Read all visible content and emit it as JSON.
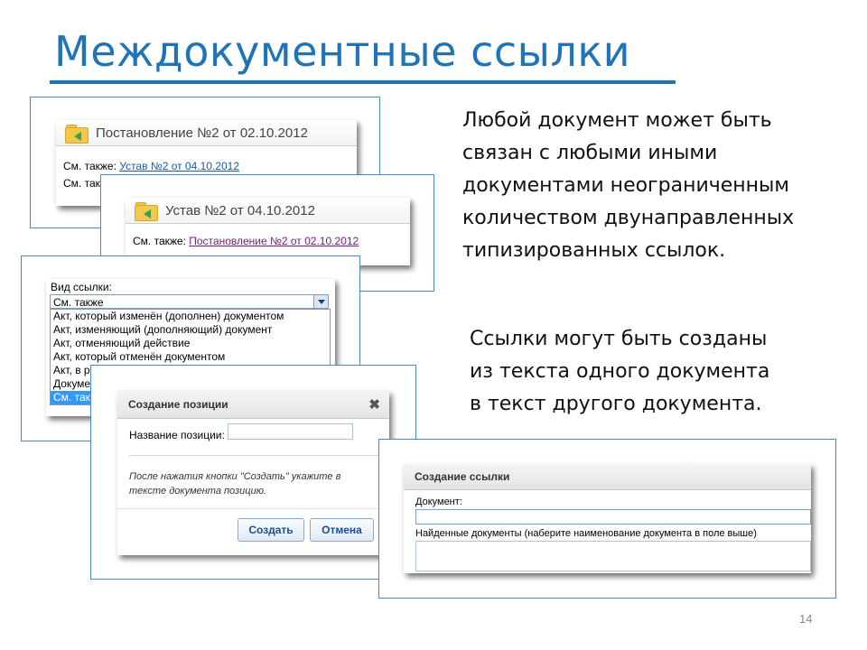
{
  "slide": {
    "title": "Междокументные ссылки",
    "paragraph1": [
      "Любой документ может быть",
      "связан с любыми иными",
      "документами неограниченным",
      "количеством двунаправленных",
      "типизированных ссылок."
    ],
    "paragraph2": [
      "Ссылки могут быть созданы",
      "из текста одного документа",
      "в текст другого документа."
    ],
    "page_number": "14",
    "accent_color": "#1f74b7"
  },
  "doc_card_1": {
    "title": "Постановление №2 от 02.10.2012",
    "see_also_label": "См. также:",
    "see_also_link": "Устав №2 от 04.10.2012",
    "see_also_label_2": "См. так"
  },
  "doc_card_2": {
    "title": "Устав №2 от 04.10.2012",
    "see_also_label": "См. также:",
    "see_also_link": "Постановление №2 от 02.10.2012"
  },
  "link_type": {
    "label": "Вид ссылки:",
    "selected": "См. также",
    "options": [
      "Акт, который изменён (дополнен) документом",
      "Акт, изменяющий (дополняющий) документ",
      "Акт, отменяющий действие",
      "Акт, который отменён документом",
      "Акт, в р",
      "Докуме",
      "См. так"
    ]
  },
  "create_position_dialog": {
    "title": "Создание позиции",
    "field_label": "Название позиции:",
    "field_value": "",
    "hint": "После нажатия кнопки \"Создать\" укажите в тексте документа позицию.",
    "create_button": "Создать",
    "cancel_button": "Отмена"
  },
  "create_link_dialog": {
    "title": "Создание ссылки",
    "document_label": "Документ:",
    "document_value": "",
    "found_label": "Найденные документы (наберите наименование документа в поле выше)"
  }
}
